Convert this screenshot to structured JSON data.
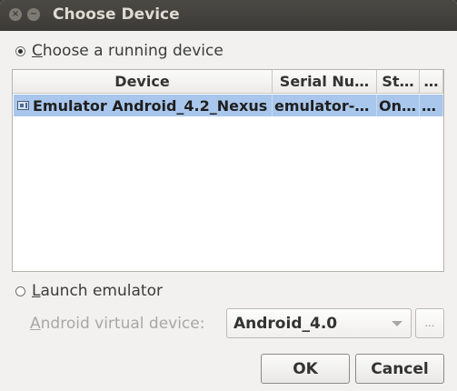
{
  "window": {
    "title": "Choose Device",
    "close_glyph": "×",
    "minimize_glyph": "−"
  },
  "running": {
    "label_first": "C",
    "label_rest": "hoose a running device"
  },
  "table": {
    "columns": [
      "Device",
      "Serial Nu…",
      "St…",
      "…"
    ],
    "rows": [
      {
        "device": "Emulator Android_4.2_Nexus",
        "serial": "emulator-…",
        "state": "On…",
        "extra": "…"
      }
    ]
  },
  "launch": {
    "label_first": "L",
    "label_rest": "aunch emulator"
  },
  "avd": {
    "label_first": "A",
    "label_rest": "ndroid virtual device:",
    "value": "Android_4.0",
    "browse_label": "…"
  },
  "buttons": {
    "ok": "OK",
    "cancel": "Cancel"
  }
}
